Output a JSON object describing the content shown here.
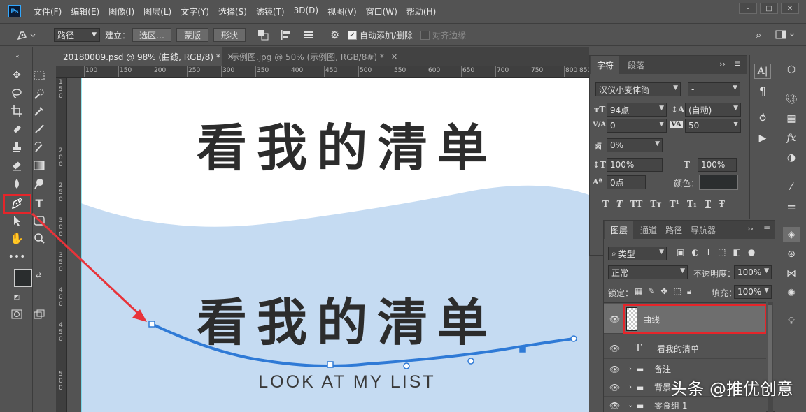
{
  "app": {
    "logo": "Ps"
  },
  "menu": [
    "文件(F)",
    "编辑(E)",
    "图像(I)",
    "图层(L)",
    "文字(Y)",
    "选择(S)",
    "滤镜(T)",
    "3D(D)",
    "视图(V)",
    "窗口(W)",
    "帮助(H)"
  ],
  "window_controls": [
    "–",
    "□",
    "✕"
  ],
  "options": {
    "mode_select": "路径",
    "make_label": "建立：",
    "selection_btn": "选区…",
    "mask_btn": "蒙版",
    "shape_btn": "形状",
    "auto_add_delete": "自动添加/删除",
    "align_edges": "对齐边缘"
  },
  "tabs": [
    {
      "label": "20180009.psd @ 98% (曲线, RGB/8) *",
      "active": true
    },
    {
      "label": "示例图.jpg @ 50% (示例图, RGB/8#) *",
      "active": false
    }
  ],
  "ruler": {
    "h": [
      "100",
      "150",
      "200",
      "250",
      "300",
      "350",
      "400",
      "450",
      "500",
      "550",
      "600",
      "650",
      "700",
      "750",
      "800",
      "850"
    ],
    "v": [
      "1",
      "5",
      "0",
      "2",
      "0",
      "0",
      "2",
      "5",
      "0",
      "3",
      "0",
      "0",
      "3",
      "5",
      "0",
      "4",
      "0",
      "0",
      "4",
      "5",
      "0",
      "5",
      "0",
      "0"
    ]
  },
  "canvas": {
    "title_top": "看我的清单",
    "title_bottom": "看我的清单",
    "subtitle": "LOOK AT MY LIST",
    "wave_color": "#c5dbf2",
    "path_color": "#2f7ad6"
  },
  "character_panel": {
    "tabs": [
      "字符",
      "段落"
    ],
    "font_family": "汉仪小麦体简",
    "font_style": "-",
    "size": "94点",
    "leading": "(自动)",
    "kerning": "0",
    "tracking": "50",
    "scale_pct": "0%",
    "vscale": "100%",
    "hscale": "100%",
    "baseline": "0点",
    "color_label": "颜色：",
    "style_buttons": [
      "T",
      "T",
      "TT",
      "Tт",
      "T¹",
      "T₁",
      "T",
      "Ŧ"
    ]
  },
  "layers_panel": {
    "tabs": [
      "图层",
      "通道",
      "路径",
      "导航器"
    ],
    "filter_kind": "类型",
    "blend_mode": "正常",
    "opacity_label": "不透明度：",
    "opacity": "100%",
    "lock_label": "锁定：",
    "fill_label": "填充：",
    "fill": "100%",
    "layers": [
      {
        "name": "曲线",
        "kind": "pixel",
        "selected": true
      },
      {
        "name": "看我的清单",
        "kind": "text",
        "selected": false
      },
      {
        "name": "备注",
        "kind": "group",
        "selected": false
      },
      {
        "name": "背景",
        "kind": "group",
        "selected": false
      },
      {
        "name": "零食组 1",
        "kind": "group",
        "selected": false
      }
    ]
  },
  "watermark": "头条 @推优创意",
  "colors": {
    "highlight": "#e5252a",
    "arrow": "#e8333a"
  }
}
